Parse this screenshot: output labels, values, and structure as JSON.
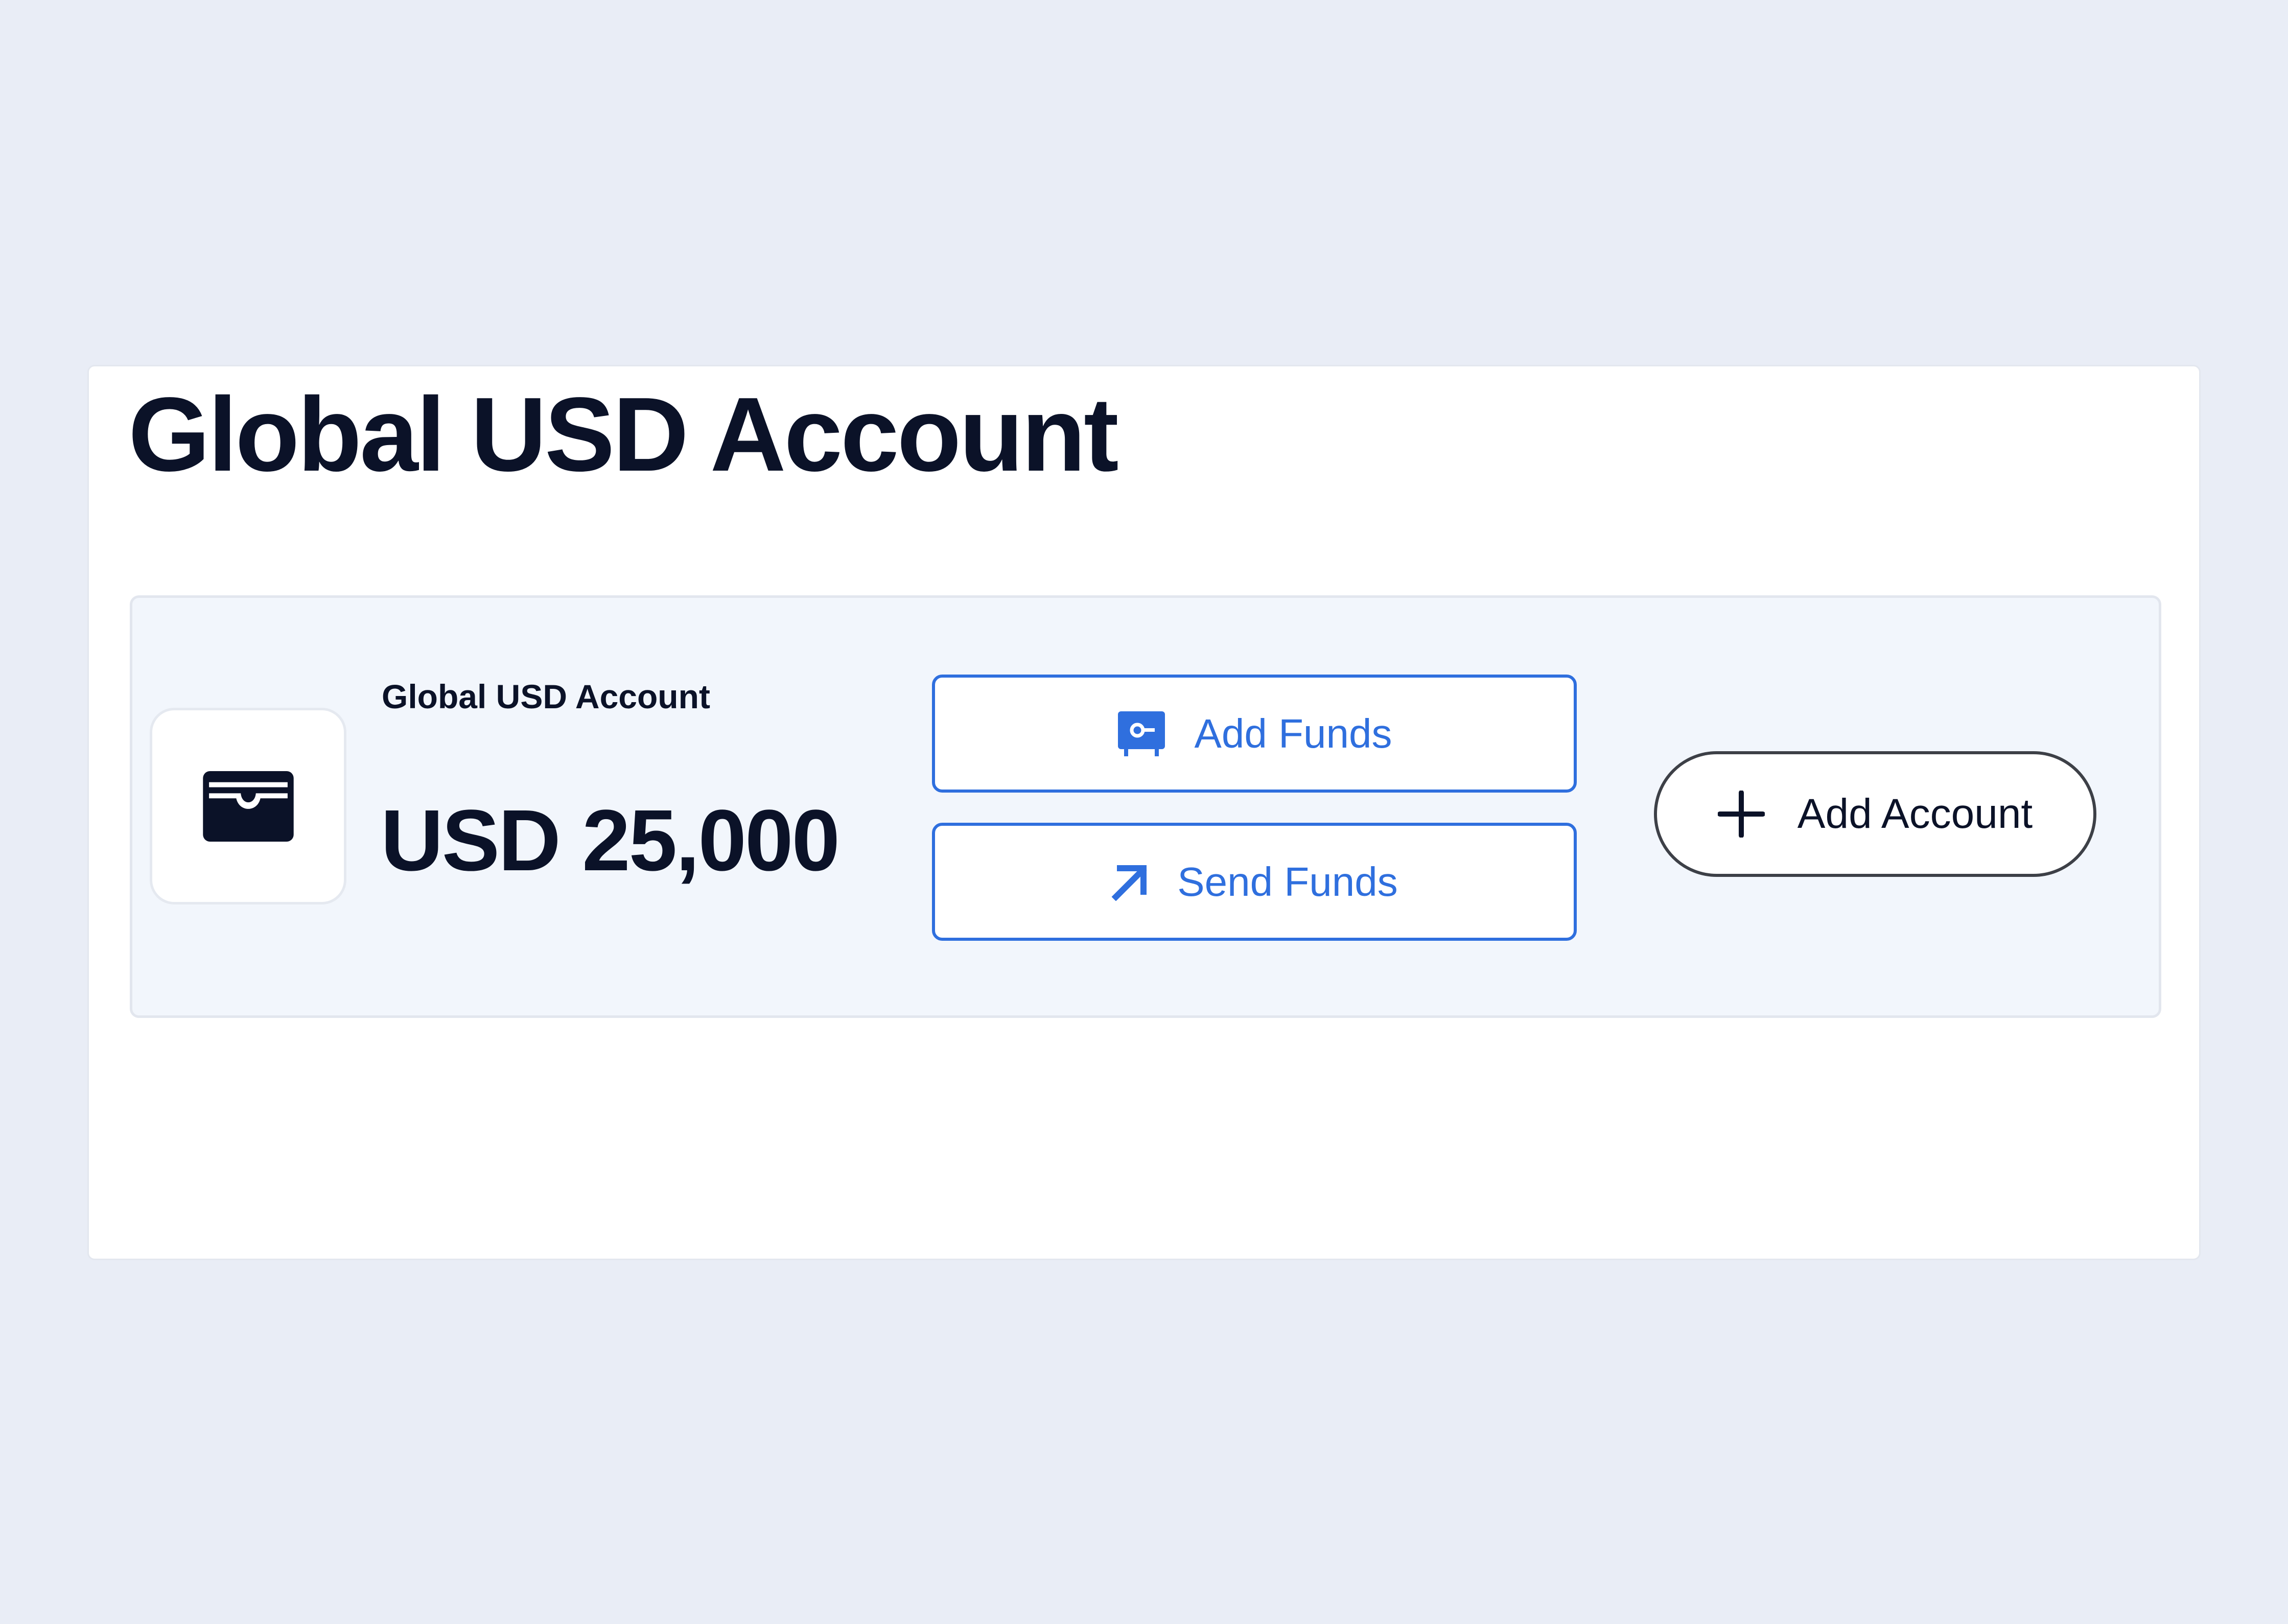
{
  "page": {
    "title": "Global USD Account"
  },
  "account": {
    "name": "Global USD Account",
    "balance": "USD 25,000",
    "icon": "wallet-icon"
  },
  "actions": {
    "add_funds_label": "Add Funds",
    "add_funds_icon": "safe-icon",
    "send_funds_label": "Send Funds",
    "send_funds_icon": "arrow-up-right-icon",
    "add_account_label": "Add Account",
    "add_account_icon": "plus-icon"
  },
  "colors": {
    "background": "#e9edf6",
    "accent": "#2f6fde",
    "text": "#0b1228",
    "card": "#f2f6fc"
  }
}
